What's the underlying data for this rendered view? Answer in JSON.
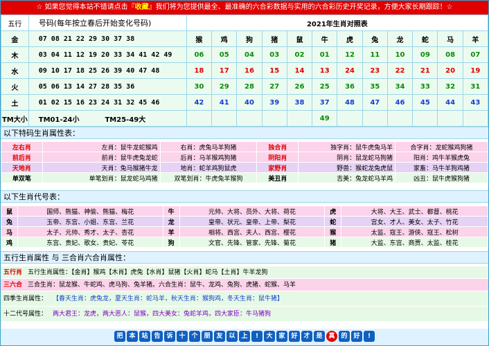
{
  "banner": {
    "pre": "☆ 如果您觉得本站不错请点击『",
    "action": "收藏",
    "post": "』我们将为您提供最全、最准确的六合彩数据与实用的六合彩历史开奖记录，方便大家长期跟踪！☆"
  },
  "table1": {
    "head_wuxing": "五行",
    "head_numbers": "号码(每年按立春后开始变化号码)",
    "head_year": "2021年生肖对照表",
    "zodiac": [
      "猴",
      "鸡",
      "狗",
      "猪",
      "鼠",
      "牛",
      "虎",
      "兔",
      "龙",
      "蛇",
      "马",
      "羊"
    ],
    "rows": [
      {
        "element": "金",
        "numbers": "07 08 21 22 29 30 37 38",
        "values": [],
        "color": ""
      },
      {
        "element": "木",
        "numbers": "03 04 11 12 19 20 33 34 41 42 49",
        "values": [
          "06",
          "05",
          "04",
          "03",
          "02",
          "01",
          "12",
          "11",
          "10",
          "09",
          "08",
          "07"
        ],
        "color": "g"
      },
      {
        "element": "水",
        "numbers": "09 10 17 18 25 26 39 40 47 48",
        "values": [
          "18",
          "17",
          "16",
          "15",
          "14",
          "13",
          "24",
          "23",
          "22",
          "21",
          "20",
          "19"
        ],
        "color": "r"
      },
      {
        "element": "火",
        "numbers": "05 06 13 14 27 28 35 36",
        "values": [
          "30",
          "29",
          "28",
          "27",
          "26",
          "25",
          "36",
          "35",
          "34",
          "33",
          "32",
          "31"
        ],
        "color": "g"
      },
      {
        "element": "土",
        "numbers": "01 02 15 16 23 24 31 32 45 46",
        "values": [
          "42",
          "41",
          "40",
          "39",
          "38",
          "37",
          "48",
          "47",
          "46",
          "45",
          "44",
          "43"
        ],
        "color": "b"
      }
    ],
    "tm_label": "TM大小",
    "tm_small": "TM01-24小",
    "tm_big": "TM25-49大",
    "extra": "49"
  },
  "section1": {
    "title": "以下特码生肖属性表："
  },
  "attr_rows": [
    {
      "bg": "pink",
      "c1": "左右肖",
      "c1c": "red",
      "c2": "左肖：鼠牛龙蛇猴鸡",
      "c3": "右肖：虎兔马羊狗猪",
      "c4": "独合肖",
      "c4c": "red",
      "c5": "独字肖：鼠牛虎兔马羊",
      "c6": "合字肖：龙蛇猴鸡狗猪"
    },
    {
      "bg": "pink",
      "c1": "前后肖",
      "c1c": "red",
      "c2": "前肖：鼠牛虎兔龙蛇",
      "c3": "后肖：马羊猴鸡狗猪",
      "c4": "阴阳肖",
      "c4c": "red",
      "c5": "阴肖：鼠龙蛇马狗猪",
      "c6": "阳肖：鸡牛羊猴虎兔"
    },
    {
      "bg": "lav",
      "c1": "天地肖",
      "c1c": "red",
      "c2": "天肖：兔马猴猪牛龙",
      "c3": "地肖：蛇羊鸡狗鼠虎",
      "c4": "家野肖",
      "c4c": "red",
      "c5": "野兽：猴蛇龙兔虎鼠",
      "c6": "家畜：马牛羊狗鸡猪"
    },
    {
      "bg": "gre",
      "c1": "单双笔",
      "c1c": "",
      "c2": "单笔划肖：鼠龙蛇马鸡猪",
      "c3": "双笔划肖：牛虎兔羊猴狗",
      "c4": "美丑肖",
      "c4c": "",
      "c5": "吉美：兔龙蛇马羊鸡",
      "c6": "凶丑：鼠牛虎猴狗猪"
    }
  ],
  "section2": {
    "title": "以下生肖代号表："
  },
  "code_rows": [
    {
      "bg": "pink",
      "a": "鼠",
      "ad": "国师、熊猫、神偷、熊猫、梅花",
      "b": "牛",
      "bd": "元帅、大将、员外、大将、荷花",
      "c": "虎",
      "cd": "大将、大王、武士、都督、桃花"
    },
    {
      "bg": "lav",
      "a": "兔",
      "ad": "玉帝、东宫、小姐、东宫、兰花",
      "b": "龙",
      "bd": "皇帝、状元、皇帝、上帝、梨花",
      "c": "蛇",
      "cd": "宫女、才人、美女、太子、竹花"
    },
    {
      "bg": "pink",
      "a": "马",
      "ad": "太子、元帅、秀才、太子、杏花",
      "b": "羊",
      "bd": "相将、西宫、夫人、西宫、樱花",
      "c": "猴",
      "cd": "太监、寇王、游侠、寇王、松树"
    },
    {
      "bg": "gre",
      "a": "鸡",
      "ad": "东宫、贵妃、歌女、贵妃、苓花",
      "b": "狗",
      "bd": "文官、先锋、管家、先锋、菊花",
      "c": "猪",
      "cd": "大监、东宫、商贾、太监、桂花"
    }
  ],
  "section3": {
    "title": "五行生肖属性 与 三合肖六合肖属性："
  },
  "rows3": [
    {
      "bg": "gre",
      "label": "五行肖",
      "labelc": "red",
      "text": "五行生肖属性：【金肖】猴鸡【木肖】虎兔【水肖】鼠猪【火肖】蛇马【土肖】牛羊龙狗"
    },
    {
      "bg": "pink",
      "label": "三六合",
      "labelc": "red",
      "text": "三合生肖：鼠龙猴、牛蛇鸡、虎马狗、兔羊猪。六合生肖：鼠牛、龙鸡、兔狗、虎猪、蛇猴、马羊"
    },
    {
      "bg": "gre",
      "label": "四季生肖属性：",
      "labelc": "",
      "text": "【春天生肖：虎兔龙，夏天生肖：蛇马羊，秋天生肖：猴狗鸡，冬天生肖：鼠牛猪】"
    },
    {
      "bg": "gre",
      "label": "十二代号属性：",
      "labelc": "",
      "text": "两大君王：龙虎，两大恶人：鼠猴，四大美女：兔蛇羊鸡，四大家臣：牛马猪狗"
    }
  ],
  "footer": [
    "把",
    "本",
    "站",
    "告",
    "诉",
    "十",
    "个",
    "朋",
    "友",
    "以",
    "上",
    "!",
    "大",
    "家",
    "好",
    "才",
    "是",
    "真",
    "的",
    "好",
    "!"
  ]
}
